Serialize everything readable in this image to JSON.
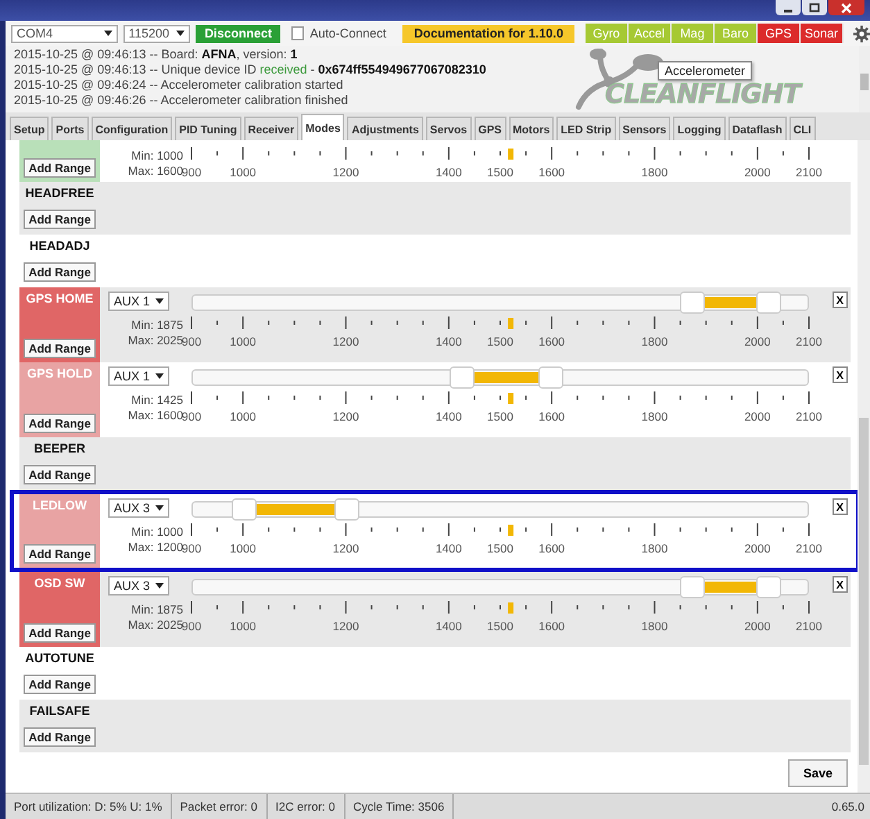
{
  "header": {
    "port": "COM4",
    "baud": "115200",
    "connect_button": "Disconnect",
    "auto_connect": {
      "label": "Auto-Connect",
      "checked": false
    },
    "docs_button": "Documentation for 1.10.0",
    "sensors": [
      {
        "label": "Gyro",
        "on": true
      },
      {
        "label": "Accel",
        "on": true
      },
      {
        "label": "Mag",
        "on": true
      },
      {
        "label": "Baro",
        "on": true
      },
      {
        "label": "GPS",
        "on": false
      },
      {
        "label": "Sonar",
        "on": false
      }
    ]
  },
  "log": [
    [
      {
        "text": "2015-10-25 @ 09:46:13 -- Board: ",
        "kind": "plain"
      },
      {
        "text": "AFNA",
        "kind": "bold"
      },
      {
        "text": ", version: ",
        "kind": "plain"
      },
      {
        "text": "1",
        "kind": "bold"
      }
    ],
    [
      {
        "text": "2015-10-25 @ 09:46:13 -- Unique device ID ",
        "kind": "plain"
      },
      {
        "text": "received",
        "kind": "ok"
      },
      {
        "text": " - ",
        "kind": "plain"
      },
      {
        "text": "0x674ff554949677067082310",
        "kind": "bold"
      }
    ],
    [
      {
        "text": "2015-10-25 @ 09:46:24 -- Accelerometer calibration started",
        "kind": "plain"
      }
    ],
    [
      {
        "text": "2015-10-25 @ 09:46:26 -- Accelerometer calibration finished",
        "kind": "plain"
      }
    ]
  ],
  "logo": "CLEANFLIGHT",
  "tooltip": "Accelerometer",
  "tabs": [
    {
      "label": "Setup",
      "selected": false
    },
    {
      "label": "Ports",
      "selected": false
    },
    {
      "label": "Configuration",
      "selected": false
    },
    {
      "label": "PID Tuning",
      "selected": false
    },
    {
      "label": "Receiver",
      "selected": false
    },
    {
      "label": "Modes",
      "selected": true
    },
    {
      "label": "Adjustments",
      "selected": false
    },
    {
      "label": "Servos",
      "selected": false
    },
    {
      "label": "GPS",
      "selected": false
    },
    {
      "label": "Motors",
      "selected": false
    },
    {
      "label": "LED Strip",
      "selected": false
    },
    {
      "label": "Sensors",
      "selected": false
    },
    {
      "label": "Logging",
      "selected": false
    },
    {
      "label": "Dataflash",
      "selected": false
    },
    {
      "label": "CLI",
      "selected": false
    }
  ],
  "modes": [
    {
      "kind": "range",
      "color": "#b9e0b9",
      "highlighted": false,
      "add_button": "Add Range",
      "min": "Min: 1000",
      "max": "Max: 1600",
      "marker": {
        "level": 0.517
      },
      "scale": [
        "900",
        "1000",
        "1200",
        "1400",
        "1500",
        "1600",
        "1800",
        "2000",
        "2100"
      ]
    },
    {
      "kind": "empty",
      "name": "HEADFREE",
      "highlighted": false,
      "add_button": "Add Range"
    },
    {
      "kind": "empty",
      "name": "HEADADJ",
      "highlighted": false,
      "add_button": "Add Range"
    },
    {
      "kind": "range",
      "name": "GPS HOME",
      "color": "#e06666",
      "highlighted": false,
      "add_button": "Add Range",
      "channel": "AUX 1",
      "slider": {
        "low": {
          "level": 0.8125
        },
        "high": {
          "level": 0.9375
        }
      },
      "remove": "X",
      "min": "Min: 1875",
      "max": "Max: 2025",
      "marker": {
        "level": 0.517
      },
      "scale": [
        "900",
        "1000",
        "1200",
        "1400",
        "1500",
        "1600",
        "1800",
        "2000",
        "2100"
      ]
    },
    {
      "kind": "range",
      "name": "GPS HOLD",
      "color": "#e8a3a3",
      "highlighted": false,
      "add_button": "Add Range",
      "channel": "AUX 1",
      "slider": {
        "low": {
          "level": 0.4375
        },
        "high": {
          "level": 0.5833
        }
      },
      "remove": "X",
      "min": "Min: 1425",
      "max": "Max: 1600",
      "marker": {
        "level": 0.517
      },
      "scale": [
        "900",
        "1000",
        "1200",
        "1400",
        "1500",
        "1600",
        "1800",
        "2000",
        "2100"
      ]
    },
    {
      "kind": "empty",
      "name": "BEEPER",
      "highlighted": false,
      "add_button": "Add Range"
    },
    {
      "kind": "range",
      "name": "LEDLOW",
      "color": "#e8a3a3",
      "highlighted": true,
      "add_button": "Add Range",
      "channel": "AUX 3",
      "slider": {
        "low": {
          "level": 0.0833
        },
        "high": {
          "level": 0.25
        }
      },
      "remove": "X",
      "min": "Min: 1000",
      "max": "Max: 1200",
      "marker": {
        "level": 0.517
      },
      "scale": [
        "900",
        "1000",
        "1200",
        "1400",
        "1500",
        "1600",
        "1800",
        "2000",
        "2100"
      ]
    },
    {
      "kind": "range",
      "name": "OSD SW",
      "color": "#e06666",
      "highlighted": false,
      "add_button": "Add Range",
      "channel": "AUX 3",
      "slider": {
        "low": {
          "level": 0.8125
        },
        "high": {
          "level": 0.9375
        }
      },
      "remove": "X",
      "min": "Min: 1875",
      "max": "Max: 2025",
      "marker": {
        "level": 0.517
      },
      "scale": [
        "900",
        "1000",
        "1200",
        "1400",
        "1500",
        "1600",
        "1800",
        "2000",
        "2100"
      ]
    },
    {
      "kind": "empty",
      "name": "AUTOTUNE",
      "highlighted": false,
      "add_button": "Add Range"
    },
    {
      "kind": "empty",
      "name": "FAILSAFE",
      "highlighted": false,
      "add_button": "Add Range"
    }
  ],
  "save_button": "Save",
  "status_bar": [
    "Port utilization: D: 5% U: 1%",
    "Packet error: 0",
    "I2C error: 0",
    "Cycle Time: 3506"
  ],
  "version": "0.65.0"
}
